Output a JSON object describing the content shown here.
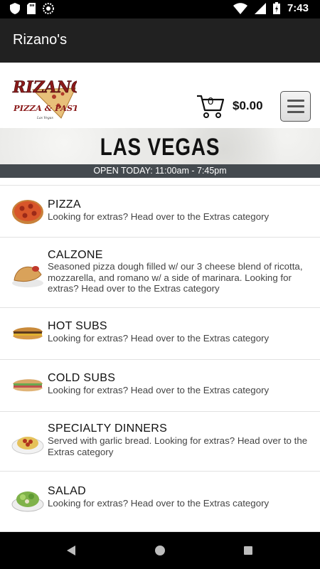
{
  "status": {
    "time": "7:43"
  },
  "app": {
    "title": "Rizano's"
  },
  "logo": {
    "line1": "RIZANOS",
    "line2": "PIZZA & PASTA",
    "line3": "Las Vegas"
  },
  "cart": {
    "count": "0",
    "total": "$0.00"
  },
  "banner": {
    "title": "LAS VEGAS",
    "hours": "OPEN TODAY: 11:00am - 7:45pm"
  },
  "menu": [
    {
      "title": "PIZZA",
      "desc": "Looking for extras? Head over to the Extras category",
      "icon": "pizza-icon"
    },
    {
      "title": "CALZONE",
      "desc": "Seasoned pizza dough filled w/ our 3 cheese blend of ricotta, mozzarella, and romano w/ a side of marinara. Looking for extras? Head over to the Extras category",
      "icon": "calzone-icon"
    },
    {
      "title": "HOT SUBS",
      "desc": "Looking for extras? Head over to the Extras category",
      "icon": "hot-sub-icon"
    },
    {
      "title": "COLD SUBS",
      "desc": "Looking for extras? Head over to the Extras category",
      "icon": "cold-sub-icon"
    },
    {
      "title": "SPECIALTY DINNERS",
      "desc": "Served with garlic bread. Looking for extras? Head over to the Extras category",
      "icon": "pasta-icon"
    },
    {
      "title": "SALAD",
      "desc": "Looking for extras? Head over to the Extras category",
      "icon": "salad-icon"
    }
  ],
  "colors": {
    "app_bar": "#212121",
    "hours_bar": "#444a4f",
    "logo_red": "#8b1a1a"
  }
}
